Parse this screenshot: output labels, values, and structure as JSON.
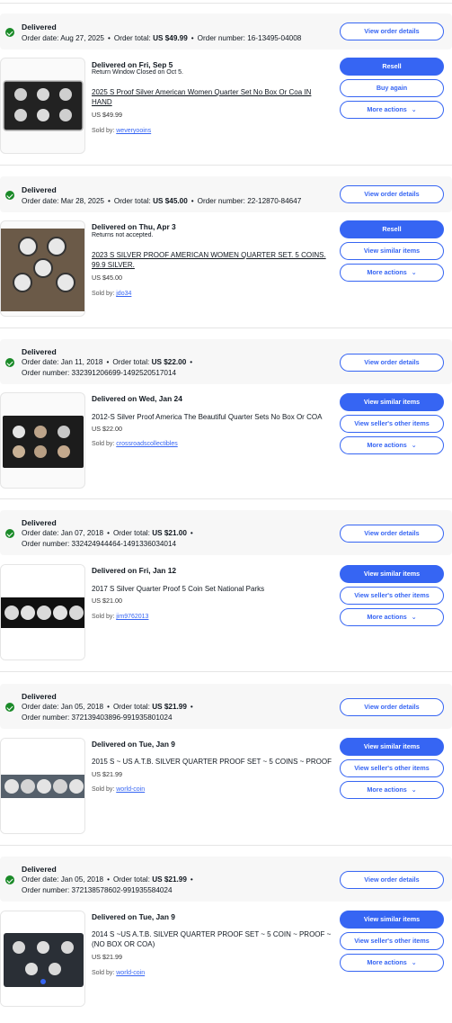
{
  "orders": [
    {
      "status": "Delivered",
      "order_date_label": "Order date:",
      "order_date": "Aug 27, 2025",
      "order_total_label": "Order total:",
      "order_total": "US $49.99",
      "order_number_label": "Order number:",
      "order_number": "16-13495-04008",
      "view_details": "View order details",
      "delivered_text": "Delivered on Fri, Sep 5",
      "note": "Return Window Closed on Oct 5.",
      "item_title": "2025 S Proof Silver American Women Quarter Set No Box Or Coa IN HAND",
      "price": "US $49.99",
      "sold_by_label": "Sold by:",
      "seller": "weveryooins",
      "btn1": "Resell",
      "btn2": "Buy again",
      "btn3": "More actions"
    },
    {
      "status": "Delivered",
      "order_date_label": "Order date:",
      "order_date": "Mar 28, 2025",
      "order_total_label": "Order total:",
      "order_total": "US $45.00",
      "order_number_label": "Order number:",
      "order_number": "22-12870-84647",
      "view_details": "View order details",
      "delivered_text": "Delivered on Thu, Apr 3",
      "note": "Returns not accepted.",
      "item_title": "2023 S SILVER PROOF AMERICAN WOMEN QUARTER SET. 5 COINS. 99.9 SILVER.",
      "price": "US $45.00",
      "sold_by_label": "Sold by:",
      "seller": "jdo34",
      "btn1": "Resell",
      "btn2": "View similar items",
      "btn3": "More actions"
    },
    {
      "status": "Delivered",
      "order_date_label": "Order date:",
      "order_date": "Jan 11, 2018",
      "order_total_label": "Order total:",
      "order_total": "US $22.00",
      "order_number_label": "Order number:",
      "order_number": "332391206699-1492520517014",
      "view_details": "View order details",
      "delivered_text": "Delivered on Wed, Jan 24",
      "item_title": "2012-S Silver Proof America The Beautiful Quarter Sets No Box Or COA",
      "price": "US $22.00",
      "sold_by_label": "Sold by:",
      "seller": "crossroadscollectibles",
      "btn1": "View similar items",
      "btn2": "View seller's other items",
      "btn3": "More actions"
    },
    {
      "status": "Delivered",
      "order_date_label": "Order date:",
      "order_date": "Jan 07, 2018",
      "order_total_label": "Order total:",
      "order_total": "US $21.00",
      "order_number_label": "Order number:",
      "order_number": "332424944464-1491336034014",
      "view_details": "View order details",
      "delivered_text": "Delivered on Fri, Jan 12",
      "item_title": "2017 S Silver Quarter Proof 5 Coin Set National Parks",
      "price": "US $21.00",
      "sold_by_label": "Sold by:",
      "seller": "jim9762013",
      "btn1": "View similar items",
      "btn2": "View seller's other items",
      "btn3": "More actions"
    },
    {
      "status": "Delivered",
      "order_date_label": "Order date:",
      "order_date": "Jan 05, 2018",
      "order_total_label": "Order total:",
      "order_total": "US $21.99",
      "order_number_label": "Order number:",
      "order_number": "372139403896-991935801024",
      "view_details": "View order details",
      "delivered_text": "Delivered on Tue, Jan 9",
      "item_title": "2015 S ~ US A.T.B. SILVER QUARTER PROOF SET ~ 5 COINS ~ PROOF",
      "price": "US $21.99",
      "sold_by_label": "Sold by:",
      "seller": "world-coin",
      "btn1": "View similar items",
      "btn2": "View seller's other items",
      "btn3": "More actions"
    },
    {
      "status": "Delivered",
      "order_date_label": "Order date:",
      "order_date": "Jan 05, 2018",
      "order_total_label": "Order total:",
      "order_total": "US $21.99",
      "order_number_label": "Order number:",
      "order_number": "372138578602-991935584024",
      "view_details": "View order details",
      "delivered_text": "Delivered on Tue, Jan 9",
      "item_title": "2014 S ~US A.T.B. SILVER QUARTER PROOF SET ~ 5 COIN ~ PROOF ~ (NO BOX OR COA)",
      "price": "US $21.99",
      "sold_by_label": "Sold by:",
      "seller": "world-coin",
      "btn1": "View similar items",
      "btn2": "View seller's other items",
      "btn3": "More actions"
    }
  ],
  "colors": {
    "accent": "#3665f3",
    "success": "#1a8a28",
    "header_bg": "#f7f7f7"
  },
  "icons": {
    "status": "checkmark-circle-icon",
    "more": "chevron-down-icon"
  }
}
